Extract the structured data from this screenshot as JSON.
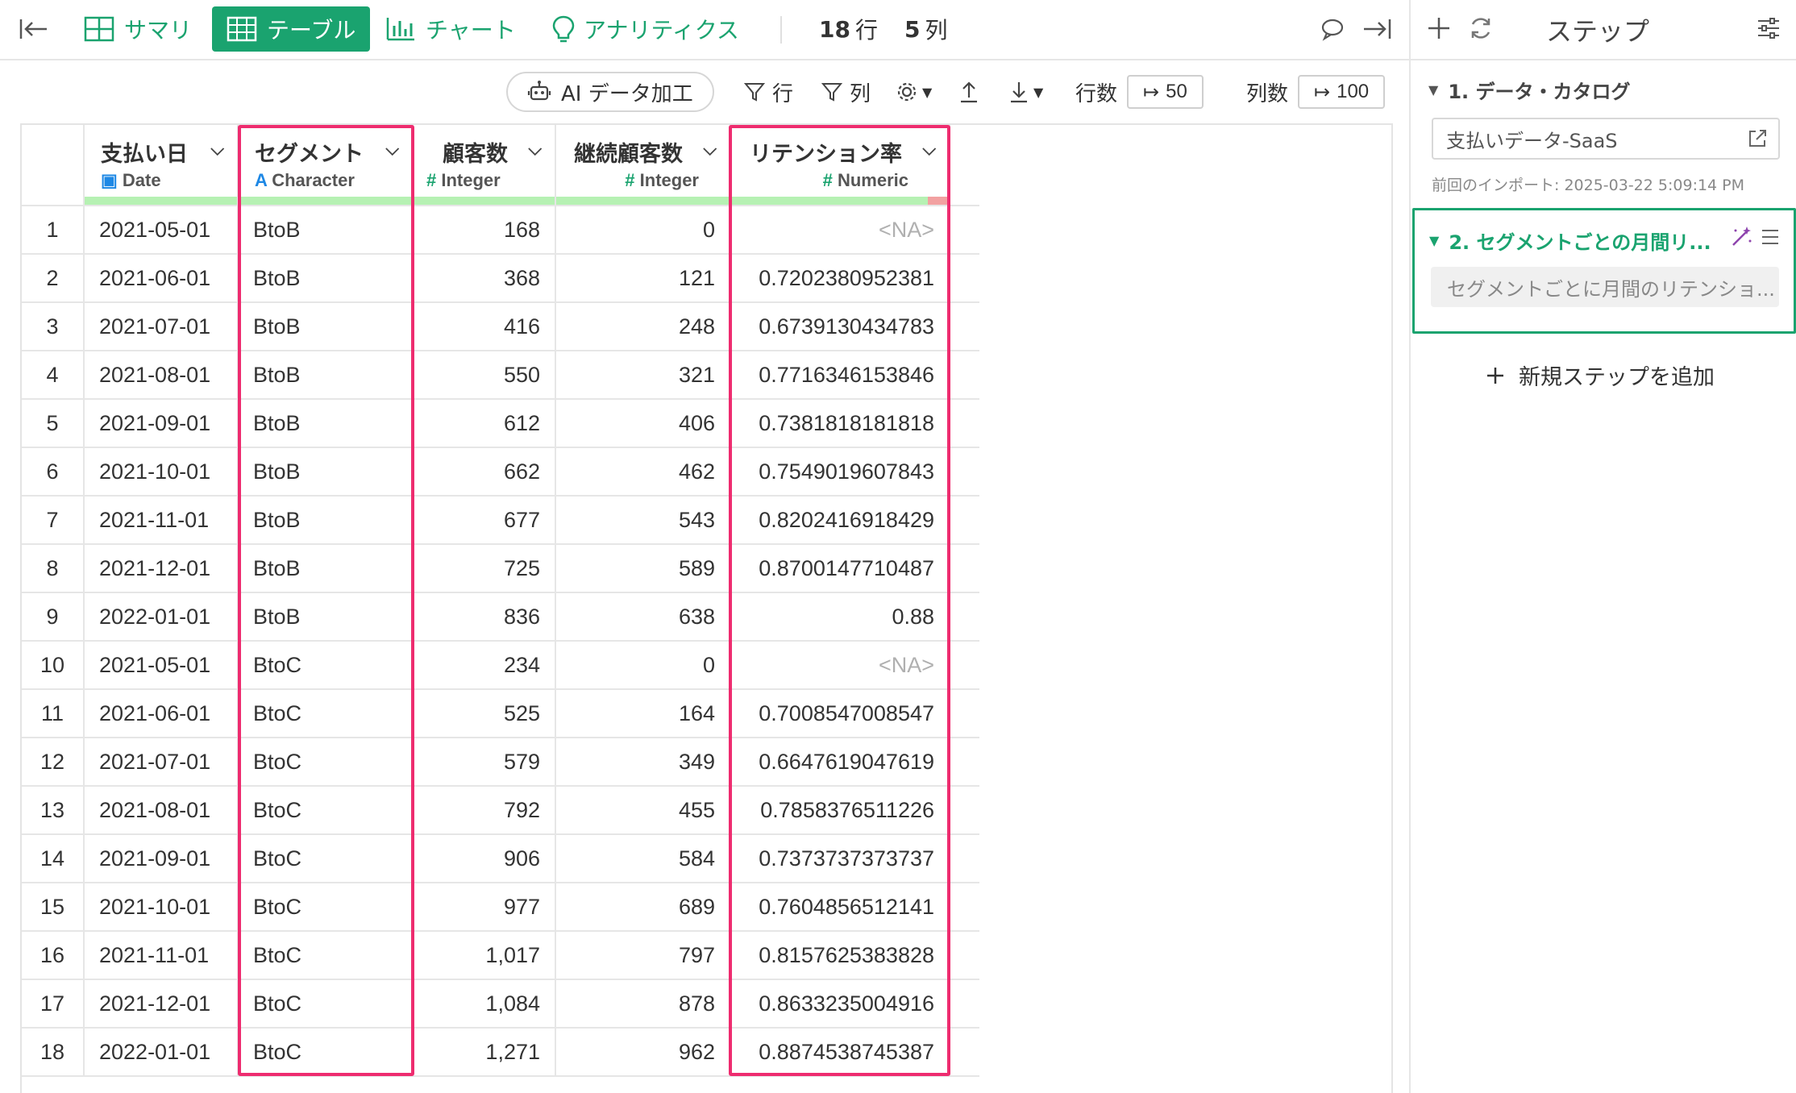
{
  "toolbar": {
    "tabs": [
      {
        "label": "サマリ",
        "icon": "grid-icon"
      },
      {
        "label": "テーブル",
        "icon": "table-icon",
        "active": true
      },
      {
        "label": "チャート",
        "icon": "bar-chart-icon"
      },
      {
        "label": "アナリティクス",
        "icon": "lightbulb-icon"
      }
    ],
    "rows_count": "18",
    "rows_unit": "行",
    "cols_count": "5",
    "cols_unit": "列"
  },
  "toolbar2": {
    "ai_label": "AI データ加工",
    "filter_row_label": "行",
    "filter_col_label": "列",
    "row_count_label": "行数",
    "row_count_value": "50",
    "col_count_label": "列数",
    "col_count_value": "100"
  },
  "table": {
    "columns": [
      {
        "name": "支払い日",
        "type": "Date"
      },
      {
        "name": "セグメント",
        "type": "Character"
      },
      {
        "name": "顧客数",
        "type": "Integer"
      },
      {
        "name": "継続顧客数",
        "type": "Integer"
      },
      {
        "name": "リテンション率",
        "type": "Numeric"
      }
    ],
    "rows": [
      [
        "1",
        "2021-05-01",
        "BtoB",
        "168",
        "0",
        "<NA>"
      ],
      [
        "2",
        "2021-06-01",
        "BtoB",
        "368",
        "121",
        "0.7202380952381"
      ],
      [
        "3",
        "2021-07-01",
        "BtoB",
        "416",
        "248",
        "0.6739130434783"
      ],
      [
        "4",
        "2021-08-01",
        "BtoB",
        "550",
        "321",
        "0.7716346153846"
      ],
      [
        "5",
        "2021-09-01",
        "BtoB",
        "612",
        "406",
        "0.7381818181818"
      ],
      [
        "6",
        "2021-10-01",
        "BtoB",
        "662",
        "462",
        "0.7549019607843"
      ],
      [
        "7",
        "2021-11-01",
        "BtoB",
        "677",
        "543",
        "0.8202416918429"
      ],
      [
        "8",
        "2021-12-01",
        "BtoB",
        "725",
        "589",
        "0.8700147710487"
      ],
      [
        "9",
        "2022-01-01",
        "BtoB",
        "836",
        "638",
        "0.88"
      ],
      [
        "10",
        "2021-05-01",
        "BtoC",
        "234",
        "0",
        "<NA>"
      ],
      [
        "11",
        "2021-06-01",
        "BtoC",
        "525",
        "164",
        "0.7008547008547"
      ],
      [
        "12",
        "2021-07-01",
        "BtoC",
        "579",
        "349",
        "0.6647619047619"
      ],
      [
        "13",
        "2021-08-01",
        "BtoC",
        "792",
        "455",
        "0.7858376511226"
      ],
      [
        "14",
        "2021-09-01",
        "BtoC",
        "906",
        "584",
        "0.7373737373737"
      ],
      [
        "15",
        "2021-10-01",
        "BtoC",
        "977",
        "689",
        "0.7604856512141"
      ],
      [
        "16",
        "2021-11-01",
        "BtoC",
        "1,017",
        "797",
        "0.8157625383828"
      ],
      [
        "17",
        "2021-12-01",
        "BtoC",
        "1,084",
        "878",
        "0.8633235004916"
      ],
      [
        "18",
        "2022-01-01",
        "BtoC",
        "1,271",
        "962",
        "0.8874538745387"
      ]
    ]
  },
  "panel": {
    "title": "ステップ",
    "step1_title": "1. データ・カタログ",
    "step1_source": "支払いデータ-SaaS",
    "step1_import_note": "前回のインポート: 2025-03-22 5:09:14 PM",
    "step2_title": "2. セグメントごとの月間リ...",
    "step2_desc": "セグメントごとに月間のリテンショ...",
    "add_step": "新規ステップを追加"
  },
  "colors": {
    "accent": "#1aa36f",
    "highlight": "#ee2c6f",
    "quality_ok": "#b6f1b3",
    "quality_missing": "#f2a1a1",
    "type_icon_blue": "#1e88e5",
    "magic_wand": "#8e44ad"
  }
}
